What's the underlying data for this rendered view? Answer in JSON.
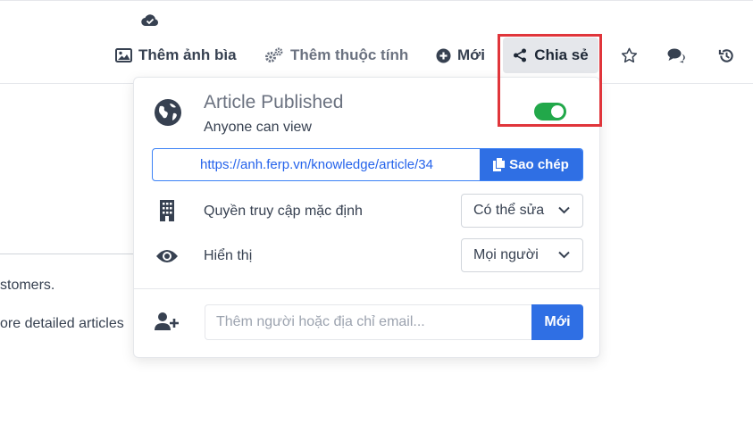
{
  "toolbar": {
    "cover_label": "Thêm ảnh bìa",
    "property_label": "Thêm thuộc tính",
    "new_label": "Mới",
    "share_label": "Chia sẻ"
  },
  "background": {
    "line1": "stomers.",
    "line2": "ore detailed articles"
  },
  "share_popover": {
    "title": "Article Published",
    "subtitle": "Anyone can view",
    "published": true,
    "url": "https://anh.ferp.vn/knowledge/article/34",
    "copy_label": "Sao chép",
    "default_access_label": "Quyền truy cập mặc định",
    "default_access_value": "Có thể sửa",
    "visibility_label": "Hiển thị",
    "visibility_value": "Mọi người",
    "invite_placeholder": "Thêm người hoặc địa chỉ email...",
    "invite_button": "Mới"
  },
  "colors": {
    "accent": "#2f6fe4",
    "toggle_on": "#22a84a",
    "highlight": "#e0353b"
  }
}
